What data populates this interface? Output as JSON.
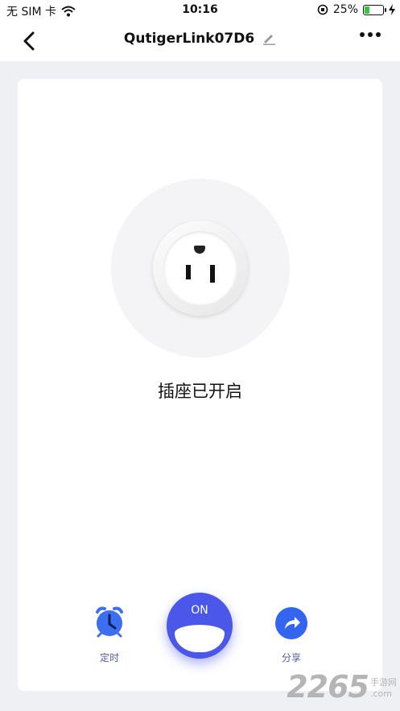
{
  "status_bar": {
    "carrier": "无 SIM 卡",
    "time": "10:16",
    "battery": "25%",
    "battery_level": 0.25
  },
  "header": {
    "title": "QutigerLink07D6"
  },
  "device": {
    "status": "插座已开启",
    "power_label": "ON"
  },
  "actions": {
    "timer_label": "定时",
    "share_label": "分享"
  },
  "colors": {
    "accent": "#4b57e8",
    "share": "#3465ef",
    "timer": "#3d6ef0"
  },
  "watermark": {
    "number": "2265",
    "top": "手游网",
    "bottom": ".com"
  }
}
